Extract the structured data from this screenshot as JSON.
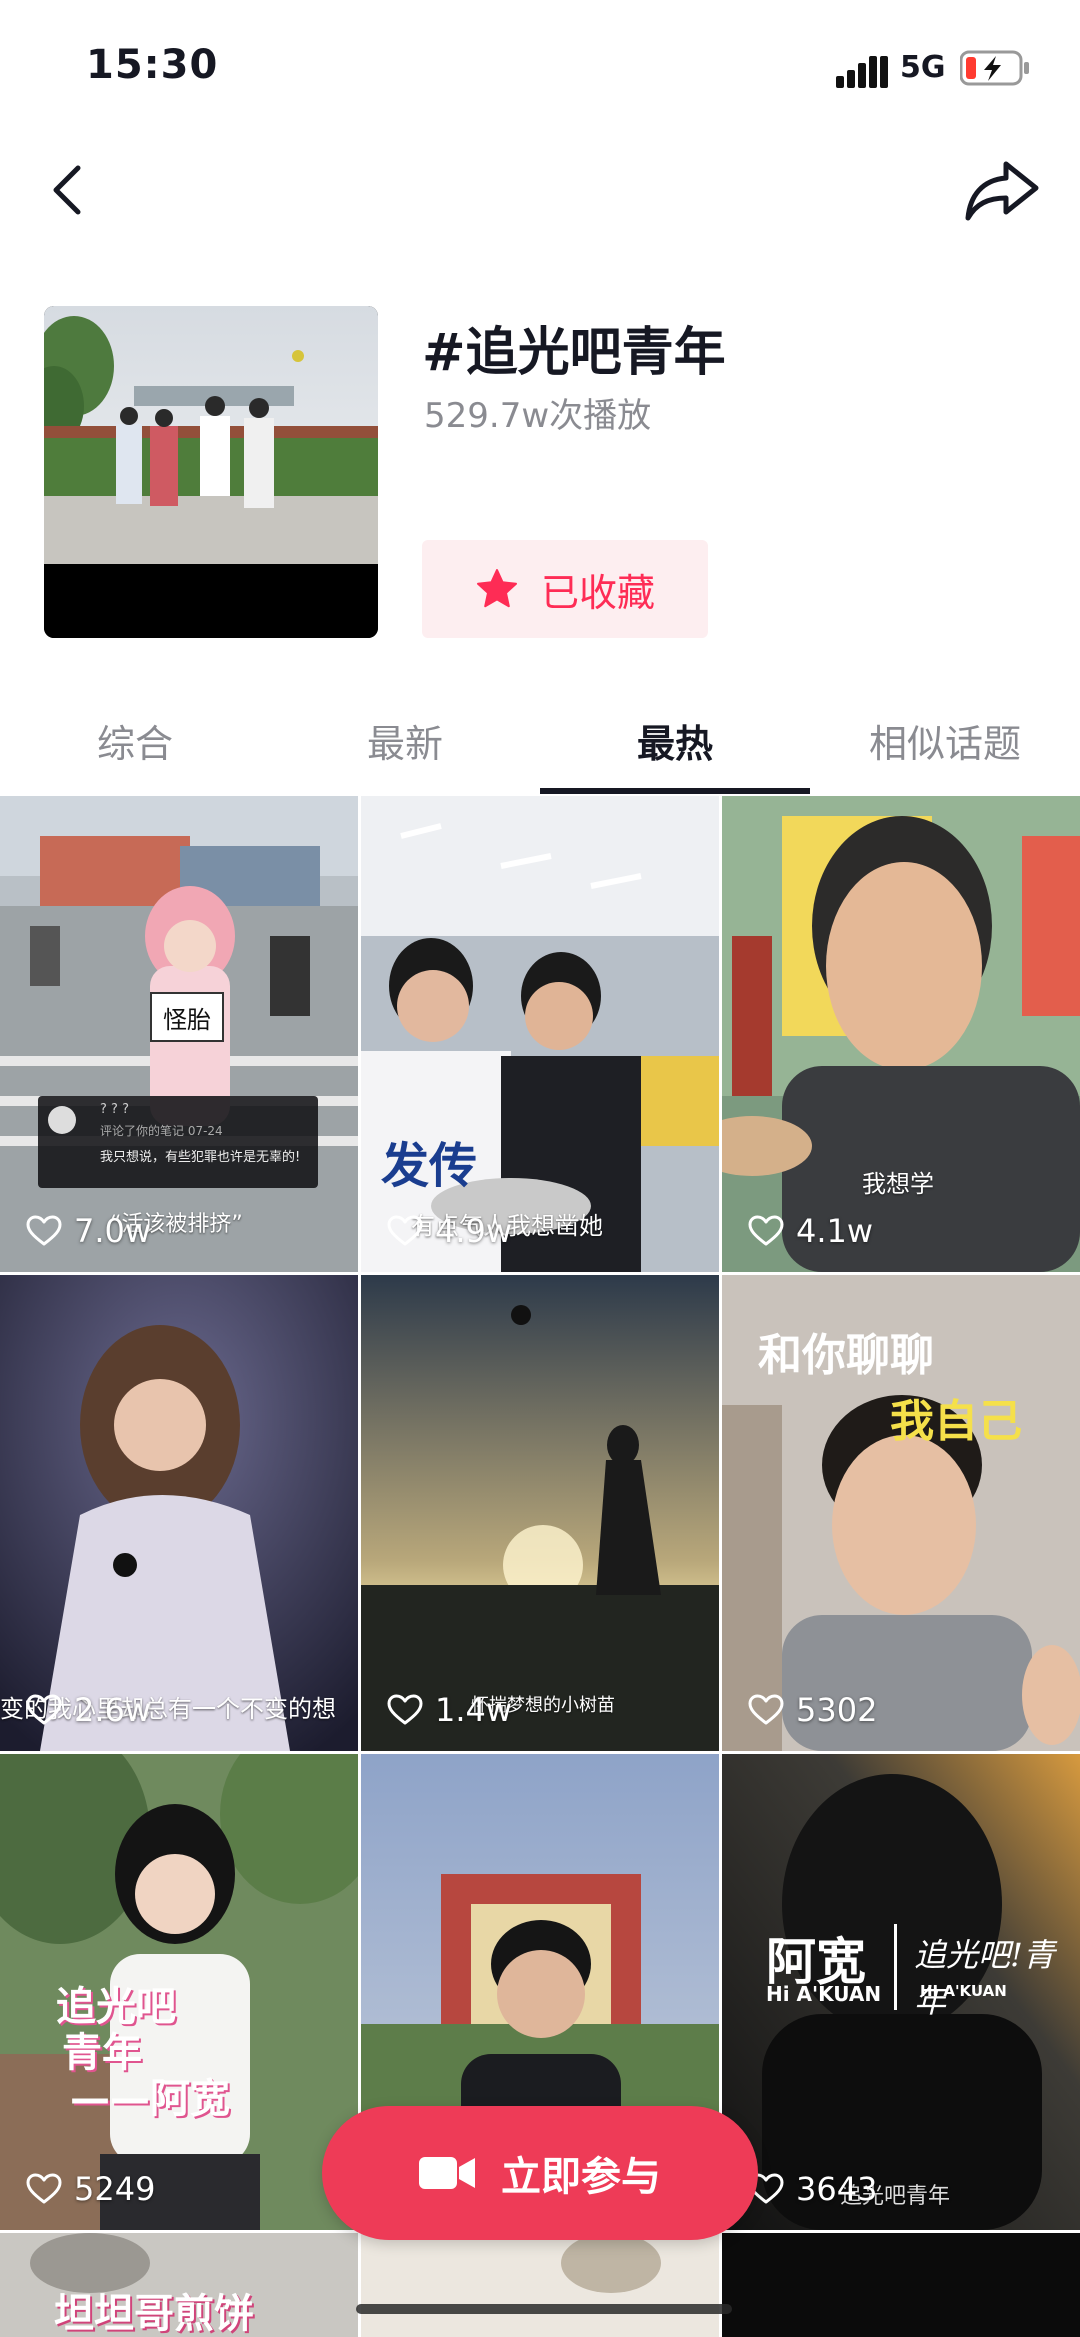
{
  "status": {
    "time": "15:30",
    "network": "5G"
  },
  "topic": {
    "title": "#追光吧青年",
    "plays": "529.7w次播放",
    "fav_label": "已收藏"
  },
  "tabs": [
    {
      "label": "综合"
    },
    {
      "label": "最新"
    },
    {
      "label": "最热",
      "active": true
    },
    {
      "label": "相似话题"
    }
  ],
  "videos": [
    {
      "likes": "7.0w",
      "caption": "“活该被排挤”",
      "sign": "怪胎",
      "comment_user": "? ? ?",
      "comment_meta": "评论了你的笔记 07-24",
      "comment_text": "我只想说，有些犯罪也许是无辜的!"
    },
    {
      "likes": "4.9w",
      "caption": "有点气人我想凿她",
      "jersey": "发传"
    },
    {
      "likes": "4.1w",
      "caption": "我想学"
    },
    {
      "likes": "2.6w",
      "caption": "变的我心里却总有一个不变的想"
    },
    {
      "likes": "1.4w",
      "caption": "怀揣梦想的小树苗"
    },
    {
      "likes": "5302",
      "title_line1": "和你聊聊",
      "title_line2": "我自己"
    },
    {
      "likes": "5249",
      "title_line1": "追光吧",
      "title_line2": "青年",
      "title_line3": "——阿宽"
    },
    {
      "likes": "",
      "caption": ""
    },
    {
      "likes": "3643",
      "caption": "追光吧青年",
      "brand": "阿宽",
      "brand_sub": "Hi A'KUAN",
      "logo_script": "追光吧!青年",
      "logo_sub": "HI A'KUAN"
    },
    {
      "caption": "坦坦哥煎饼"
    }
  ],
  "join_label": "立即参与",
  "colors": {
    "accent": "#fe2c55",
    "join_button": "#ee3b57",
    "muted": "#8a8b91"
  }
}
